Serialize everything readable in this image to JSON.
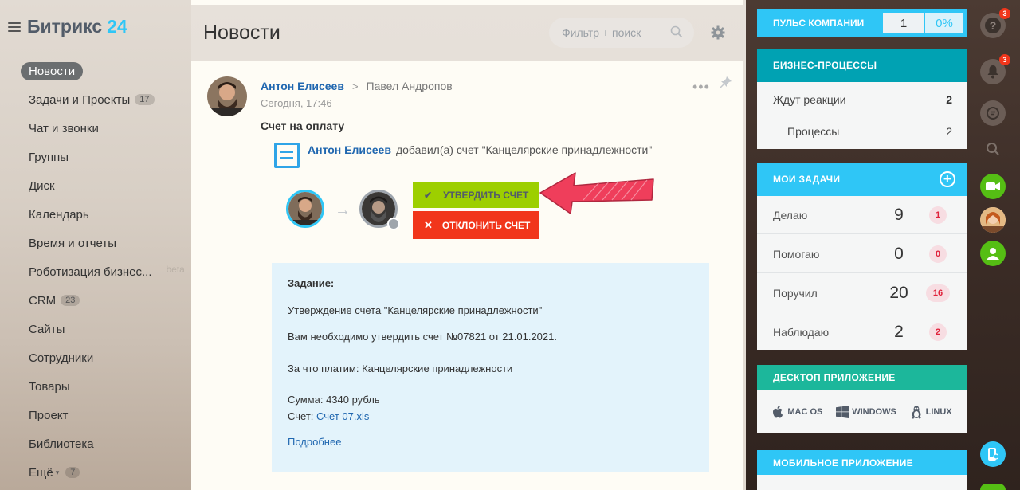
{
  "logo": {
    "name": "Битрикс",
    "number": "24"
  },
  "nav": [
    {
      "label": "Новости",
      "active": true
    },
    {
      "label": "Задачи и Проекты",
      "count": "17"
    },
    {
      "label": "Чат и звонки"
    },
    {
      "label": "Группы"
    },
    {
      "label": "Диск"
    },
    {
      "label": "Календарь"
    },
    {
      "label": "Время и отчеты"
    },
    {
      "label": "Роботизация бизнес...",
      "beta": "beta"
    },
    {
      "label": "CRM",
      "count": "23"
    },
    {
      "label": "Сайты"
    },
    {
      "label": "Сотрудники"
    },
    {
      "label": "Товары"
    },
    {
      "label": "Проект"
    },
    {
      "label": "Библиотека"
    },
    {
      "label": "Ещё",
      "count": "7",
      "caret": true
    }
  ],
  "header": {
    "title": "Новости",
    "search_placeholder": "Фильтр + поиск"
  },
  "post": {
    "author": "Антон Елисеев",
    "recipient": "Павел Андропов",
    "time": "Сегодня, 17:46",
    "subject": "Счет на оплату",
    "invoice_author": "Антон Елисеев",
    "invoice_text": "добавил(а) счет \"Канцелярские принадлежности\"",
    "approve_label": "УТВЕРДИТЬ СЧЕТ",
    "decline_label": "ОТКЛОНИТЬ СЧЕТ",
    "task": {
      "heading": "Задание:",
      "line1": "Утверждение счета \"Канцелярские принадлежности\"",
      "line2": "Вам необходимо утвердить счет №07821 от 21.01.2021.",
      "line3": "За что платим: Канцелярские принадлежности",
      "sum": "Сумма: 4340 рубль",
      "file_label": "Счет:",
      "file_name": "Счет 07.xls",
      "more": "Подробнее"
    }
  },
  "widgets": {
    "pulse": {
      "label": "ПУЛЬС КОМПАНИИ",
      "value": "1",
      "percent": "0%"
    },
    "bp": {
      "title": "БИЗНЕС-ПРОЦЕССЫ",
      "rows": [
        {
          "label": "Ждут реакции",
          "value": "2"
        },
        {
          "label": "Процессы",
          "value": "2"
        }
      ]
    },
    "tasks": {
      "title": "МОИ ЗАДАЧИ",
      "rows": [
        {
          "label": "Делаю",
          "value": "9",
          "badge": "1"
        },
        {
          "label": "Помогаю",
          "value": "0",
          "badge": "0"
        },
        {
          "label": "Поручил",
          "value": "20",
          "badge": "16"
        },
        {
          "label": "Наблюдаю",
          "value": "2",
          "badge": "2"
        }
      ]
    },
    "desktop": {
      "title": "ДЕСКТОП ПРИЛОЖЕНИЕ",
      "mac": "MAC OS",
      "windows": "WINDOWS",
      "linux": "LINUX"
    },
    "mobile": {
      "title": "МОБИЛЬНОЕ ПРИЛОЖЕНИЕ"
    }
  },
  "rail": {
    "help_badge": "3",
    "notify_badge": "3"
  },
  "colors": {
    "accent": "#2fc6f6",
    "approve": "#9dcf00",
    "decline": "#f1361b",
    "link": "#2067b0"
  }
}
